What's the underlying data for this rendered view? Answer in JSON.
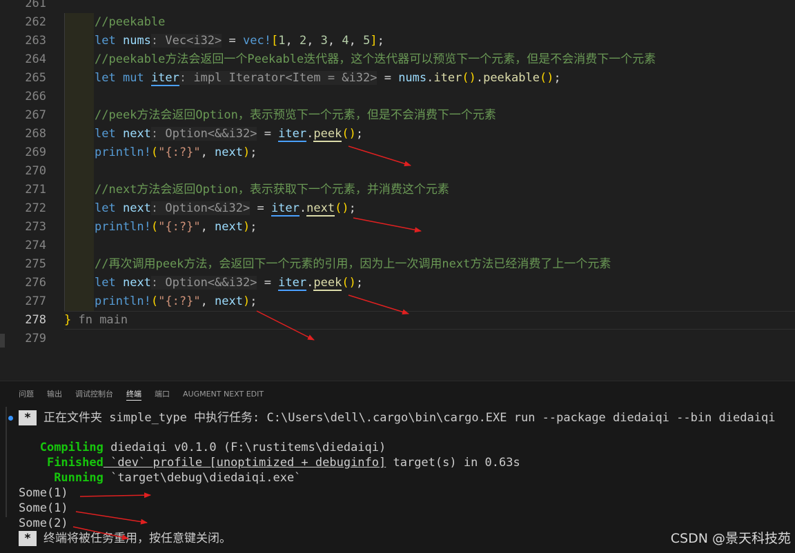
{
  "editor": {
    "lines": [
      {
        "n": "261"
      },
      {
        "n": "262",
        "comment": "//peekable"
      },
      {
        "n": "263",
        "kw1": "let",
        "name": "nums",
        "hint": ": Vec<i32>",
        "eq": " = ",
        "mac": "vec!",
        "open": "[",
        "nums": [
          "1",
          "2",
          "3",
          "4",
          "5"
        ],
        "close": "]",
        "end": ";"
      },
      {
        "n": "264",
        "comment": "//peekable方法会返回一个Peekable迭代器，这个迭代器可以预览下一个元素，但是不会消费下一个元素"
      },
      {
        "n": "265",
        "kw1": "let",
        "kw2": "mut",
        "name": "iter",
        "hint": ": impl Iterator<Item = &i32>",
        "eq": " = ",
        "obj": "nums",
        "m1": "iter",
        "m2": "peekable"
      },
      {
        "n": "266"
      },
      {
        "n": "267",
        "comment": "//peek方法会返回Option，表示预览下一个元素，但是不会消费下一个元素"
      },
      {
        "n": "268",
        "kw1": "let",
        "name": "next",
        "hint": ": Option<&&i32>",
        "eq": " = ",
        "obj": "iter",
        "method": "peek"
      },
      {
        "n": "269",
        "mac": "println!",
        "str": "\"{:?}\"",
        "arg": "next"
      },
      {
        "n": "270"
      },
      {
        "n": "271",
        "comment": "//next方法会返回Option，表示获取下一个元素，并消费这个元素"
      },
      {
        "n": "272",
        "kw1": "let",
        "name": "next",
        "hint": ": Option<&i32>",
        "eq": " = ",
        "obj": "iter",
        "method": "next"
      },
      {
        "n": "273",
        "mac": "println!",
        "str": "\"{:?}\"",
        "arg": "next"
      },
      {
        "n": "274"
      },
      {
        "n": "275",
        "comment": "//再次调用peek方法，会返回下一个元素的引用，因为上一次调用next方法已经消费了上一个元素"
      },
      {
        "n": "276",
        "kw1": "let",
        "name": "next",
        "hint": ": Option<&&i32>",
        "eq": " = ",
        "obj": "iter",
        "method": "peek"
      },
      {
        "n": "277",
        "mac": "println!",
        "str": "\"{:?}\"",
        "arg": "next"
      },
      {
        "n": "278",
        "brace": "}",
        "fold": " fn main"
      },
      {
        "n": "279"
      }
    ]
  },
  "panel": {
    "tabs": [
      "问题",
      "输出",
      "调试控制台",
      "终端",
      "端口",
      "AUGMENT NEXT EDIT"
    ],
    "active_tab": "终端",
    "task_star": "*",
    "task_line": "正在文件夹 simple_type 中执行任务: C:\\Users\\dell\\.cargo\\bin\\cargo.EXE run --package diedaiqi --bin diedaiqi",
    "compiling_label": "Compiling",
    "compiling_text": " diedaiqi v0.1.0 (F:\\rustitems\\diedaiqi)",
    "finished_label": "Finished",
    "finished_text_a": " `dev` profile [unoptimized + debuginfo]",
    "finished_text_b": " target(s) in 0.63s",
    "running_label": "Running",
    "running_text": " `target\\debug\\diedaiqi.exe`",
    "output": [
      "Some(1)",
      "Some(1)",
      "Some(2)"
    ],
    "reuse_line": "终端将被任务重用，按任意键关闭。"
  },
  "watermark": "CSDN @景天科技苑",
  "colors": {
    "background": "#1f1f1f",
    "comment": "#6a9955",
    "keyword": "#569cd6",
    "annotation_arrow": "#e02020",
    "terminal_green": "#16c60c"
  }
}
